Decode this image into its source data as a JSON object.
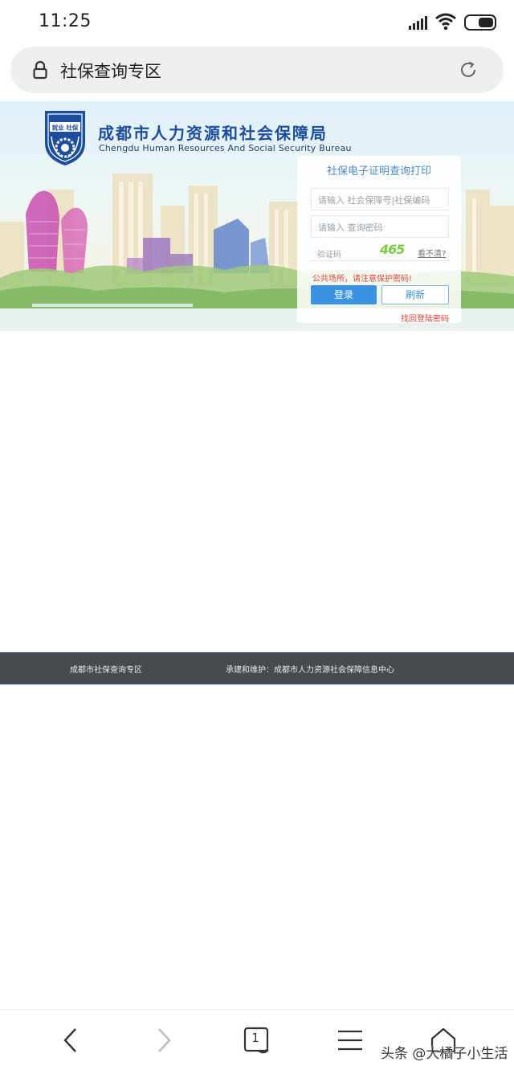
{
  "status_bar": {
    "time": "11:25"
  },
  "browser": {
    "address_text": "社保查询专区",
    "tab_count": "1"
  },
  "banner": {
    "title": "成都市人力资源和社会保障局",
    "subtitle": "Chengdu Human Resources And Social Security Bureau",
    "emblem_text": "就业 社保"
  },
  "login": {
    "title": "社保电子证明查询打印",
    "account_placeholder": "请输入 社会保障号|社保编码",
    "password_placeholder": "请输入 查询密码",
    "captcha_label": "验证码",
    "captcha_code": "465",
    "captcha_refresh": "看不清?",
    "warning": "公共场所，请注意保护密码!",
    "login_button": "登录",
    "refresh_button": "刷新",
    "forgot_link": "找回登陆密码"
  },
  "footer": {
    "left": "成都市社保查询专区",
    "right": "承建和维护：成都市人力资源社会保障信息中心"
  },
  "watermark": "头条 @大橘子小生活",
  "colors": {
    "accent": "#3a92e0",
    "title_blue": "#1d4e9c",
    "warning_red": "#e0463c",
    "footer_bg": "#464b50"
  }
}
